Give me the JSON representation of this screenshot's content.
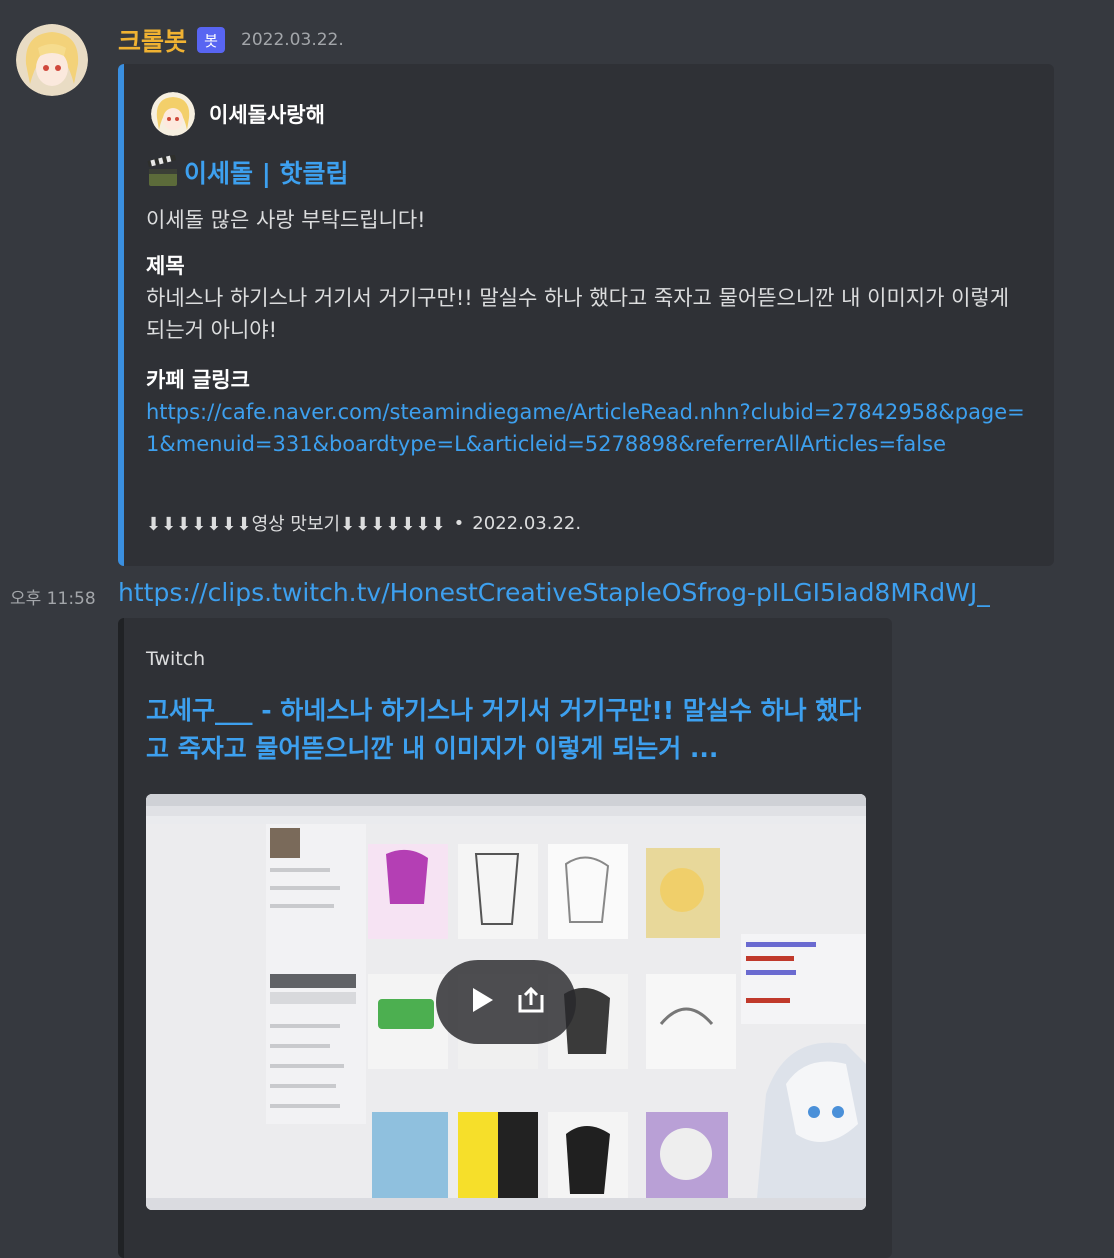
{
  "message1": {
    "username": "크롤봇",
    "bot_tag": "봇",
    "timestamp": "2022.03.22.",
    "embed": {
      "author_name": "이세돌사랑해",
      "title": "이세돌 | 핫클립",
      "description": "이세돌 많은 사랑 부탁드립니다!",
      "fields": [
        {
          "name": "제목",
          "value": "하네스나 하기스나 거기서 거기구만!! 말실수 하나 했다고 죽자고 물어뜯으니깐 내 이미지가 이렇게 되는거 아니야!"
        },
        {
          "name": "카페 글링크",
          "value": "https://cafe.naver.com/steamindiegame/ArticleRead.nhn?clubid=27842958&page=1&menuid=331&boardtype=L&articleid=5278898&referrerAllArticles=false"
        }
      ],
      "footer_text": "⬇⬇⬇⬇⬇⬇⬇영상 맛보기⬇⬇⬇⬇⬇⬇⬇",
      "footer_separator": "•",
      "footer_timestamp": "2022.03.22."
    }
  },
  "message2": {
    "time": "오후 11:58",
    "link": "https://clips.twitch.tv/HonestCreativeStapleOSfrog-pILGI5Iad8MRdWJ_",
    "embed": {
      "provider": "Twitch",
      "title": "고세구___ - 하네스나 하기스나 거기서 거기구만!! 말실수 하나 했다고 죽자고 물어뜯으니깐 내 이미지가 이렇게 되는거 ...",
      "media_icons": [
        "play-icon",
        "external-link-icon"
      ]
    }
  },
  "colors": {
    "background": "#36393f",
    "embed_bg": "#2f3136",
    "username": "#f0b232",
    "link": "#3da0ef",
    "embed1_border": "#3a8fe0",
    "bot_tag": "#5865f2"
  }
}
